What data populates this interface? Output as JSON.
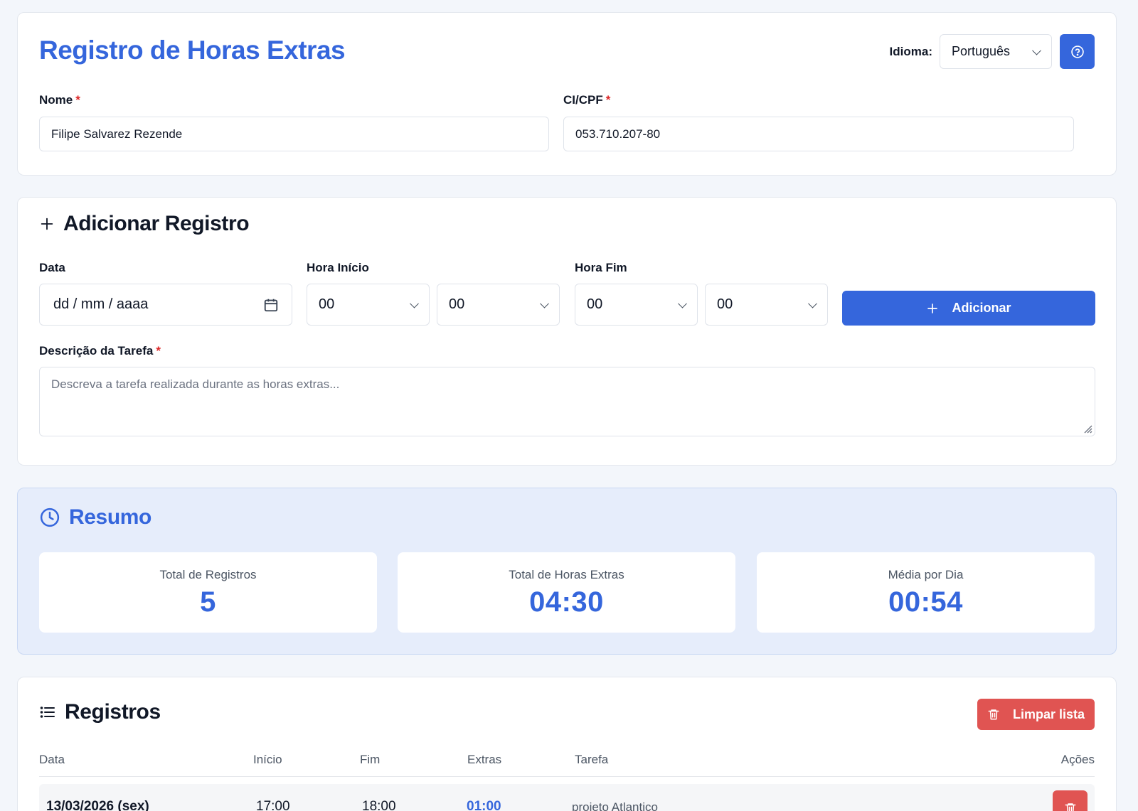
{
  "header": {
    "title": "Registro de Horas Extras",
    "language_label": "Idioma:",
    "language_value": "Português"
  },
  "person": {
    "name_label": "Nome",
    "name_value": "Filipe Salvarez Rezende",
    "id_label": "CI/CPF",
    "id_value": "053.710.207-80",
    "required_mark": "*"
  },
  "add_record": {
    "title": "Adicionar Registro",
    "date_label": "Data",
    "date_placeholder": "dd / mm / aaaa",
    "start_label": "Hora Início",
    "start_hour": "00",
    "start_minute": "00",
    "end_label": "Hora Fim",
    "end_hour": "00",
    "end_minute": "00",
    "add_button": "Adicionar",
    "task_label": "Descrição da Tarefa",
    "task_placeholder": "Descreva a tarefa realizada durante as horas extras..."
  },
  "summary": {
    "title": "Resumo",
    "stats": [
      {
        "label": "Total de Registros",
        "value": "5"
      },
      {
        "label": "Total de Horas Extras",
        "value": "04:30"
      },
      {
        "label": "Média por Dia",
        "value": "00:54"
      }
    ]
  },
  "records": {
    "title": "Registros",
    "clear_button": "Limpar lista",
    "columns": [
      "Data",
      "Início",
      "Fim",
      "Extras",
      "Tarefa",
      "Ações"
    ],
    "rows": [
      {
        "date": "13/03/2026 (sex)",
        "start": "17:00",
        "end": "18:00",
        "extras": "01:00",
        "task": "projeto Atlantico"
      }
    ]
  },
  "colors": {
    "accent": "#3566dc",
    "danger": "#e05452",
    "summary_bg": "#e6edfb"
  },
  "icons": {
    "help": "help-circle-icon",
    "add_section": "plus-icon",
    "calendar": "calendar-icon",
    "summary": "clock-icon",
    "records": "list-icon",
    "delete": "trash-icon"
  }
}
